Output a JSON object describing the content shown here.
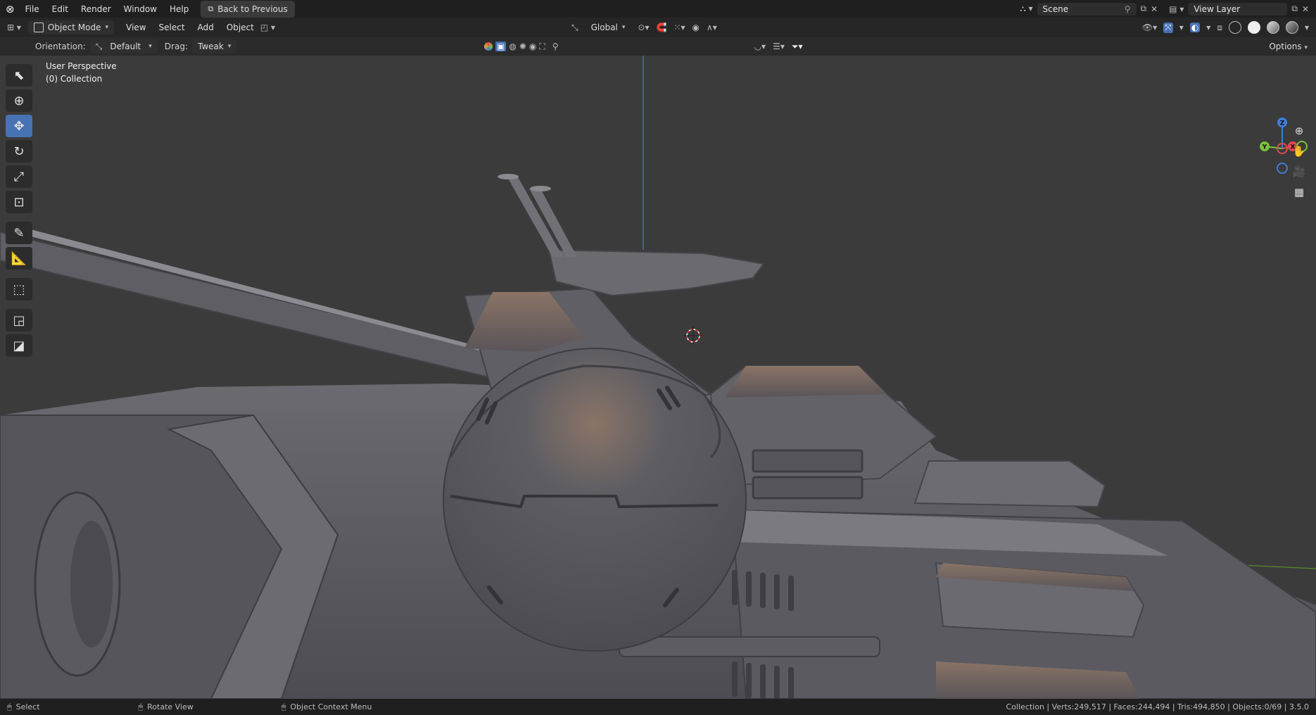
{
  "topbar": {
    "menus": [
      "File",
      "Edit",
      "Render",
      "Window",
      "Help"
    ],
    "back_button": "Back to Previous",
    "scene_name": "Scene",
    "view_layer": "View Layer"
  },
  "header": {
    "mode": "Object Mode",
    "menus": [
      "View",
      "Select",
      "Add",
      "Object"
    ],
    "transform_orientation": "Global"
  },
  "tool_header": {
    "orientation_label": "Orientation:",
    "orientation_value": "Default",
    "drag_label": "Drag:",
    "drag_value": "Tweak",
    "search_placeholder": "",
    "options_label": "Options"
  },
  "viewport": {
    "view_name": "User Perspective",
    "collection": "(0) Collection",
    "axes": {
      "z": "Z",
      "y": "Y",
      "x": "X"
    }
  },
  "statusbar": {
    "select": "Select",
    "rotate": "Rotate View",
    "context_menu": "Object Context Menu",
    "stats": "Collection | Verts:249,517 | Faces:244,494 | Tris:494,850 | Objects:0/69 | 3.5.0"
  },
  "colors": {
    "accent": "#4772b3",
    "axis_x": "#e0484d",
    "axis_y": "#7ac23a",
    "axis_z": "#3f7dd8"
  }
}
